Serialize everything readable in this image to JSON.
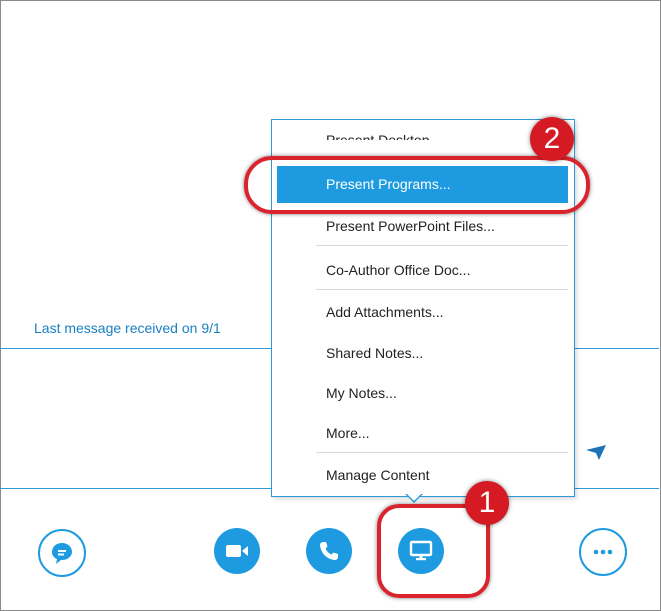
{
  "conversation": {
    "last_message": "Last message received on 9/1"
  },
  "present_menu": {
    "items": [
      {
        "label": "Present Desktop"
      },
      {
        "label": "Present Programs...",
        "selected": true
      },
      {
        "label": "Present PowerPoint Files..."
      },
      {
        "label": "Co-Author Office Doc..."
      },
      {
        "label": "Add Attachments..."
      },
      {
        "label": "Shared Notes..."
      },
      {
        "label": "My Notes..."
      },
      {
        "label": "More..."
      },
      {
        "label": "Manage Content"
      }
    ]
  },
  "toolbar": {
    "buttons": [
      {
        "icon": "im-chat-icon"
      },
      {
        "icon": "video-camera-icon"
      },
      {
        "icon": "phone-icon"
      },
      {
        "icon": "monitor-present-icon"
      },
      {
        "icon": "more-options-icon"
      }
    ]
  },
  "annotations": {
    "step1": "1",
    "step2": "2"
  },
  "colors": {
    "accent": "#1e9be0",
    "highlight_ring": "#d9242d",
    "badge": "#d51a23"
  }
}
